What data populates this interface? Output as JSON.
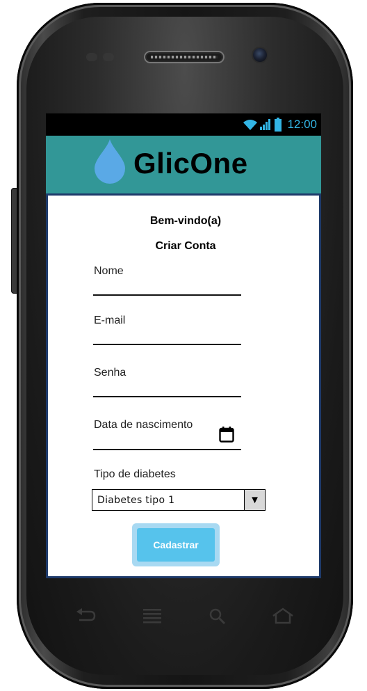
{
  "statusbar": {
    "time": "12:00",
    "icons": [
      "wifi-icon",
      "signal-icon",
      "battery-icon"
    ]
  },
  "app": {
    "title": "GlicOne",
    "logo_icon": "water-drop-icon",
    "header_color": "#329797"
  },
  "form": {
    "welcome": "Bem-vindo(a)",
    "subtitle": "Criar Conta",
    "fields": [
      {
        "label": "Nome",
        "value": ""
      },
      {
        "label": "E-mail",
        "value": ""
      },
      {
        "label": "Senha",
        "value": ""
      },
      {
        "label": "Data de nascimento",
        "value": "",
        "icon": "calendar-icon"
      }
    ],
    "diabetes_type": {
      "label": "Tipo de diabetes",
      "selected": "Diabetes tipo 1"
    },
    "submit_label": "Cadastrar"
  },
  "navigation_keys": [
    "back-icon",
    "menu-icon",
    "search-icon",
    "home-icon"
  ],
  "colors": {
    "accent": "#33b5e5",
    "button": "#56c3ec",
    "border": "#1e3a6a"
  }
}
